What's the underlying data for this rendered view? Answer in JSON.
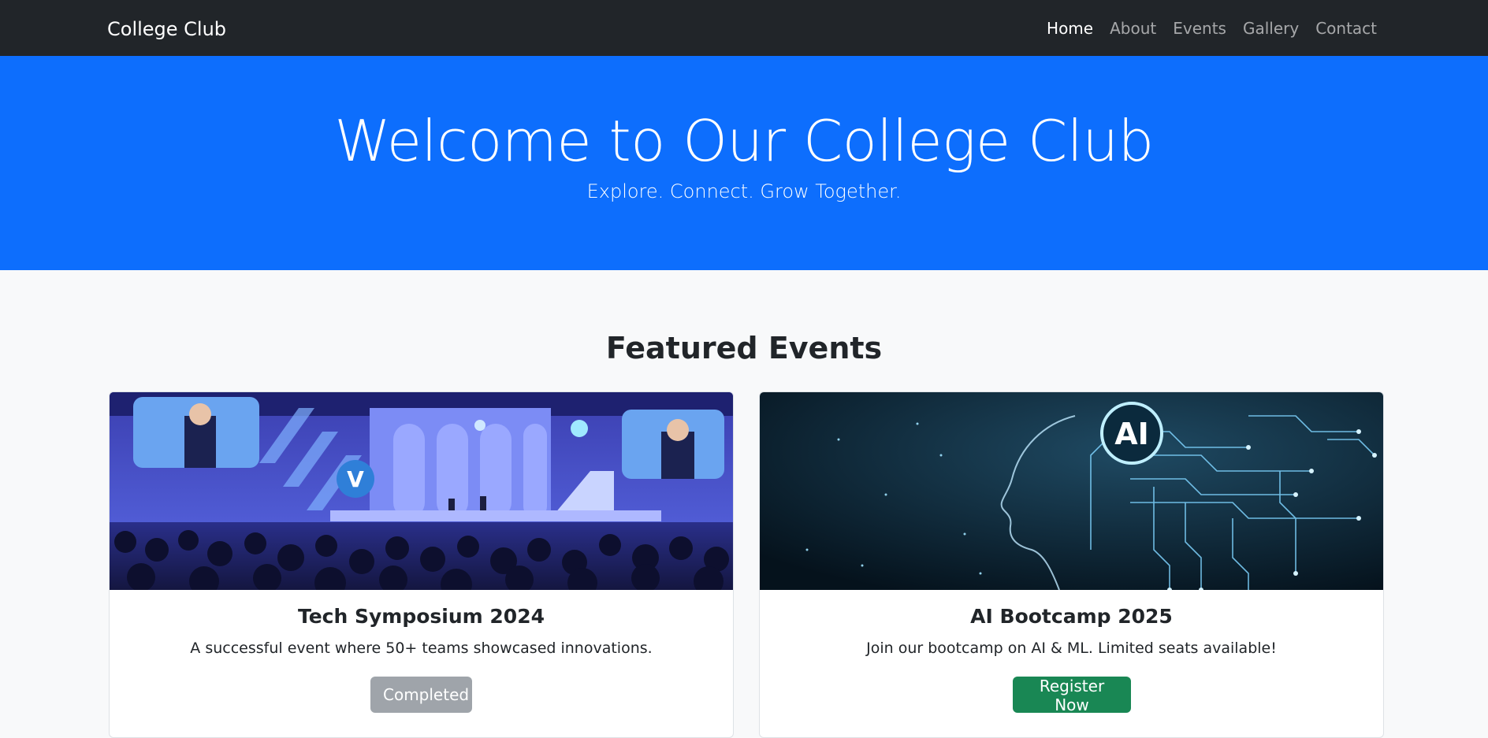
{
  "navbar": {
    "brand": "College Club",
    "links": [
      "Home",
      "About",
      "Events",
      "Gallery",
      "Contact"
    ],
    "active": "Home"
  },
  "hero": {
    "title": "Welcome to Our College Club",
    "subtitle": "Explore. Connect. Grow Together."
  },
  "events_section": {
    "heading": "Featured Events",
    "cards": [
      {
        "title": "Tech Symposium 2024",
        "text": "A successful event where 50+ teams showcased innovations.",
        "button": "Completed",
        "image": "conference-stage-photo"
      },
      {
        "title": "AI Bootcamp 2025",
        "text": "Join our bootcamp on AI & ML. Limited seats available!",
        "button": "Register Now",
        "image": "ai-brain-circuit-graphic",
        "image_label": "AI"
      }
    ]
  },
  "colors": {
    "navbar_bg": "#212529",
    "hero_bg": "#0d6efd",
    "page_bg": "#f8f9fa",
    "completed_btn": "#6c757d",
    "register_btn": "#198754"
  }
}
